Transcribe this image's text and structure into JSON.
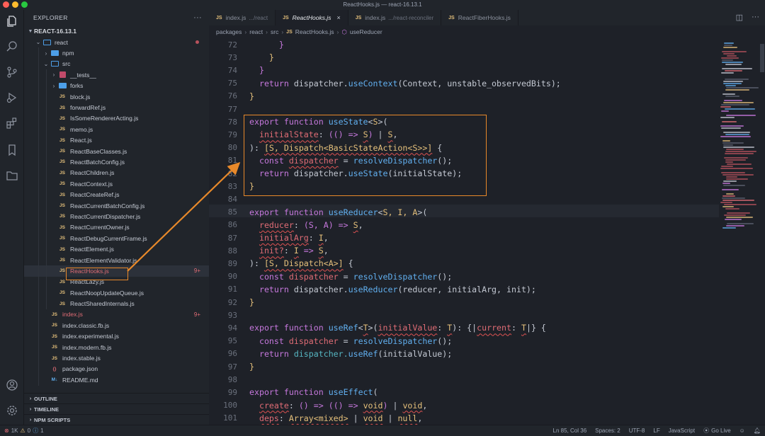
{
  "window": {
    "title": "ReactHooks.js — react-16.13.1"
  },
  "sidebar": {
    "header": "EXPLORER",
    "project": "REACT-16.13.1",
    "tree": [
      {
        "label": "react",
        "type": "folder-open",
        "depth": 1,
        "dot": true
      },
      {
        "label": "npm",
        "type": "folder",
        "depth": 2
      },
      {
        "label": "src",
        "type": "folder-open",
        "depth": 2
      },
      {
        "label": "__tests__",
        "type": "test",
        "depth": 3
      },
      {
        "label": "forks",
        "type": "folder",
        "depth": 3
      },
      {
        "label": "block.js",
        "type": "js",
        "depth": 3
      },
      {
        "label": "forwardRef.js",
        "type": "js",
        "depth": 3
      },
      {
        "label": "IsSomeRendererActing.js",
        "type": "js",
        "depth": 3
      },
      {
        "label": "memo.js",
        "type": "js",
        "depth": 3
      },
      {
        "label": "React.js",
        "type": "js",
        "depth": 3
      },
      {
        "label": "ReactBaseClasses.js",
        "type": "js",
        "depth": 3
      },
      {
        "label": "ReactBatchConfig.js",
        "type": "js",
        "depth": 3
      },
      {
        "label": "ReactChildren.js",
        "type": "js",
        "depth": 3
      },
      {
        "label": "ReactContext.js",
        "type": "js",
        "depth": 3
      },
      {
        "label": "ReactCreateRef.js",
        "type": "js",
        "depth": 3
      },
      {
        "label": "ReactCurrentBatchConfig.js",
        "type": "js",
        "depth": 3
      },
      {
        "label": "ReactCurrentDispatcher.js",
        "type": "js",
        "depth": 3
      },
      {
        "label": "ReactCurrentOwner.js",
        "type": "js",
        "depth": 3
      },
      {
        "label": "ReactDebugCurrentFrame.js",
        "type": "js",
        "depth": 3
      },
      {
        "label": "ReactElement.js",
        "type": "js",
        "depth": 3
      },
      {
        "label": "ReactElementValidator.js",
        "type": "js",
        "depth": 3
      },
      {
        "label": "ReactHooks.js",
        "type": "js",
        "depth": 3,
        "active": true,
        "red": true,
        "badge": "9+"
      },
      {
        "label": "ReactLazy.js",
        "type": "js",
        "depth": 3
      },
      {
        "label": "ReactNoopUpdateQueue.js",
        "type": "js",
        "depth": 3
      },
      {
        "label": "ReactSharedInternals.js",
        "type": "js",
        "depth": 3
      },
      {
        "label": "index.js",
        "type": "js",
        "depth": 2,
        "red": true,
        "badge": "9+"
      },
      {
        "label": "index.classic.fb.js",
        "type": "js",
        "depth": 2
      },
      {
        "label": "index.experimental.js",
        "type": "js",
        "depth": 2
      },
      {
        "label": "index.modern.fb.js",
        "type": "js",
        "depth": 2
      },
      {
        "label": "index.stable.js",
        "type": "js",
        "depth": 2
      },
      {
        "label": "package.json",
        "type": "json",
        "depth": 2
      },
      {
        "label": "README.md",
        "type": "md",
        "depth": 2
      }
    ],
    "sections": [
      "OUTLINE",
      "TIMELINE",
      "NPM SCRIPTS"
    ]
  },
  "tabs": [
    {
      "label": "index.js",
      "desc": ".../react",
      "active": false
    },
    {
      "label": "ReactHooks.js",
      "desc": "",
      "active": true
    },
    {
      "label": "index.js",
      "desc": ".../react-reconciler",
      "active": false
    },
    {
      "label": "ReactFiberHooks.js",
      "desc": "",
      "active": false
    }
  ],
  "breadcrumb": [
    "packages",
    "react",
    "src",
    "ReactHooks.js",
    "useReducer"
  ],
  "code": [
    {
      "n": "72",
      "tokens": [
        [
          "pl",
          "      "
        ],
        [
          "k",
          "}"
        ]
      ]
    },
    {
      "n": "73",
      "tokens": [
        [
          "pl",
          "    "
        ],
        [
          "t",
          "}"
        ]
      ]
    },
    {
      "n": "74",
      "tokens": [
        [
          "pl",
          "  "
        ],
        [
          "k",
          "}"
        ]
      ]
    },
    {
      "n": "75",
      "tokens": [
        [
          "pl",
          "  "
        ],
        [
          "k",
          "return "
        ],
        [
          "pl",
          "dispatcher."
        ],
        [
          "f",
          "useContext"
        ],
        [
          "pl",
          "(Context, unstable_observedBits);"
        ]
      ]
    },
    {
      "n": "76",
      "tokens": [
        [
          "t",
          "}"
        ]
      ]
    },
    {
      "n": "77",
      "tokens": []
    },
    {
      "n": "78",
      "tokens": [
        [
          "k",
          "export function "
        ],
        [
          "f",
          "useState"
        ],
        [
          "pl",
          "<"
        ],
        [
          "t",
          "S"
        ],
        [
          "pl",
          ">("
        ]
      ]
    },
    {
      "n": "79",
      "tokens": [
        [
          "pl",
          "  "
        ],
        [
          "p",
          "initialState"
        ],
        [
          "pl",
          ": "
        ],
        [
          "k",
          "(() => "
        ],
        [
          "t",
          "S"
        ],
        [
          "k",
          ")"
        ],
        [
          "pl",
          " | "
        ],
        [
          "t",
          "S"
        ],
        [
          "pl",
          ","
        ]
      ]
    },
    {
      "n": "80",
      "tokens": [
        [
          "pl",
          "): "
        ],
        [
          "t",
          "[S, Dispatch<BasicStateAction<S>>]"
        ],
        [
          "pl",
          " {"
        ]
      ]
    },
    {
      "n": "81",
      "tokens": [
        [
          "pl",
          "  "
        ],
        [
          "k",
          "const "
        ],
        [
          "p",
          "dispatcher"
        ],
        [
          "pl",
          " = "
        ],
        [
          "f",
          "resolveDispatcher"
        ],
        [
          "pl",
          "();"
        ]
      ]
    },
    {
      "n": "82",
      "tokens": [
        [
          "pl",
          "  "
        ],
        [
          "k",
          "return "
        ],
        [
          "pl",
          "dispatcher."
        ],
        [
          "f",
          "useState"
        ],
        [
          "pl",
          "(initialState);"
        ]
      ]
    },
    {
      "n": "83",
      "tokens": [
        [
          "t",
          "}"
        ]
      ]
    },
    {
      "n": "84",
      "tokens": []
    },
    {
      "n": "85",
      "tokens": [
        [
          "k",
          "export function "
        ],
        [
          "f",
          "useReducer"
        ],
        [
          "pl",
          "<"
        ],
        [
          "t",
          "S, I, A"
        ],
        [
          "pl",
          ">("
        ]
      ]
    },
    {
      "n": "86",
      "tokens": [
        [
          "pl",
          "  "
        ],
        [
          "p",
          "reducer"
        ],
        [
          "pl",
          ": "
        ],
        [
          "k",
          "(S, A) => "
        ],
        [
          "t",
          "S"
        ],
        [
          "pl",
          ","
        ]
      ]
    },
    {
      "n": "87",
      "tokens": [
        [
          "pl",
          "  "
        ],
        [
          "p",
          "initialArg"
        ],
        [
          "pl",
          ": "
        ],
        [
          "t",
          "I"
        ],
        [
          "pl",
          ","
        ]
      ]
    },
    {
      "n": "88",
      "tokens": [
        [
          "pl",
          "  "
        ],
        [
          "p",
          "init?"
        ],
        [
          "pl",
          ": "
        ],
        [
          "t",
          "I"
        ],
        [
          "k",
          " => "
        ],
        [
          "t",
          "S"
        ],
        [
          "pl",
          ","
        ]
      ]
    },
    {
      "n": "89",
      "tokens": [
        [
          "pl",
          "): "
        ],
        [
          "t",
          "[S, Dispatch<A>]"
        ],
        [
          "pl",
          " {"
        ]
      ]
    },
    {
      "n": "90",
      "tokens": [
        [
          "pl",
          "  "
        ],
        [
          "k",
          "const "
        ],
        [
          "p",
          "dispatcher"
        ],
        [
          "pl",
          " = "
        ],
        [
          "f",
          "resolveDispatcher"
        ],
        [
          "pl",
          "();"
        ]
      ]
    },
    {
      "n": "91",
      "tokens": [
        [
          "pl",
          "  "
        ],
        [
          "k",
          "return "
        ],
        [
          "pl",
          "dispatcher."
        ],
        [
          "f",
          "useReducer"
        ],
        [
          "pl",
          "(reducer, initialArg, init);"
        ]
      ]
    },
    {
      "n": "92",
      "tokens": [
        [
          "t",
          "}"
        ]
      ]
    },
    {
      "n": "93",
      "tokens": []
    },
    {
      "n": "94",
      "tokens": [
        [
          "k",
          "export function "
        ],
        [
          "f",
          "useRef"
        ],
        [
          "pl",
          "<"
        ],
        [
          "t",
          "T"
        ],
        [
          "pl",
          ">("
        ],
        [
          "p",
          "initialValue"
        ],
        [
          "pl",
          ": "
        ],
        [
          "t",
          "T"
        ],
        [
          "pl",
          "): {|"
        ],
        [
          "p",
          "current"
        ],
        [
          "pl",
          ": "
        ],
        [
          "t",
          "T"
        ],
        [
          "pl",
          "|} {"
        ]
      ]
    },
    {
      "n": "95",
      "tokens": [
        [
          "pl",
          "  "
        ],
        [
          "k",
          "const "
        ],
        [
          "p",
          "dispatcher"
        ],
        [
          "pl",
          " = "
        ],
        [
          "f",
          "resolveDispatcher"
        ],
        [
          "pl",
          "();"
        ]
      ]
    },
    {
      "n": "96",
      "tokens": [
        [
          "pl",
          "  "
        ],
        [
          "k",
          "return "
        ],
        [
          "o",
          "dispatcher."
        ],
        [
          "f",
          "useRef"
        ],
        [
          "pl",
          "(initialValue);"
        ]
      ]
    },
    {
      "n": "97",
      "tokens": [
        [
          "t",
          "}"
        ]
      ]
    },
    {
      "n": "98",
      "tokens": []
    },
    {
      "n": "99",
      "tokens": [
        [
          "k",
          "export function "
        ],
        [
          "f",
          "useEffect"
        ],
        [
          "pl",
          "("
        ]
      ]
    },
    {
      "n": "100",
      "tokens": [
        [
          "pl",
          "  "
        ],
        [
          "p",
          "create"
        ],
        [
          "pl",
          ": "
        ],
        [
          "k",
          "() => (() => "
        ],
        [
          "t",
          "void"
        ],
        [
          "k",
          ")"
        ],
        [
          "pl",
          " | "
        ],
        [
          "t",
          "void"
        ],
        [
          "pl",
          ","
        ]
      ]
    },
    {
      "n": "101",
      "tokens": [
        [
          "pl",
          "  "
        ],
        [
          "p",
          "deps"
        ],
        [
          "pl",
          ": "
        ],
        [
          "t",
          "Array<mixed>"
        ],
        [
          "pl",
          " | "
        ],
        [
          "t",
          "void"
        ],
        [
          "pl",
          " | "
        ],
        [
          "t",
          "null"
        ],
        [
          "pl",
          ","
        ]
      ]
    }
  ],
  "status": {
    "errors": "1K",
    "warnings": "0",
    "info": "1",
    "cursor": "Ln 85, Col 36",
    "spaces": "Spaces: 2",
    "encoding": "UTF-8",
    "eol": "LF",
    "language": "JavaScript",
    "golive": "Go Live"
  },
  "colors": {
    "accent_box": "#e8892a",
    "background": "#1e2128",
    "sidebar": "#21252b"
  },
  "icons": [
    "files-icon",
    "search-icon",
    "source-control-icon",
    "run-debug-icon",
    "extensions-icon",
    "bookmark-icon",
    "folder-icon",
    "account-icon",
    "settings-icon"
  ]
}
